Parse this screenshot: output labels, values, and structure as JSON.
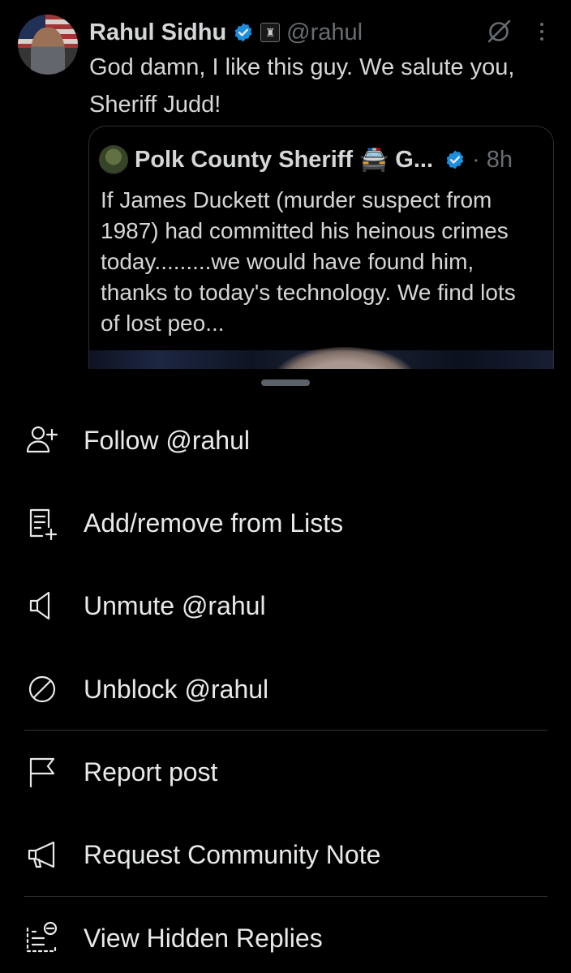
{
  "post": {
    "display_name": "Rahul Sidhu",
    "handle": "@rahul",
    "text": "God damn, I like this guy. We salute you, Sheriff Judd!",
    "quoted": {
      "name": "Polk County Sheriff 🚔 G...",
      "time": "· 8h",
      "text": "If James Duckett (murder suspect from 1987) had committed his heinous crimes today.........we would have found him, thanks to today's technology. We find lots of lost peo..."
    }
  },
  "menu": {
    "items": [
      {
        "label": "Follow @rahul",
        "icon": "follow-user-icon"
      },
      {
        "label": "Add/remove from Lists",
        "icon": "lists-add-icon"
      },
      {
        "label": "Unmute @rahul",
        "icon": "speaker-icon"
      },
      {
        "label": "Unblock @rahul",
        "icon": "block-icon"
      },
      {
        "label": "Report post",
        "icon": "flag-icon"
      },
      {
        "label": "Request Community Note",
        "icon": "megaphone-icon"
      },
      {
        "label": "View Hidden Replies",
        "icon": "hidden-replies-icon"
      }
    ]
  },
  "colors": {
    "background": "#000000",
    "text": "#e7e9ea",
    "muted": "#71767b",
    "verified": "#1d9bf0",
    "divider": "#2f3336"
  }
}
